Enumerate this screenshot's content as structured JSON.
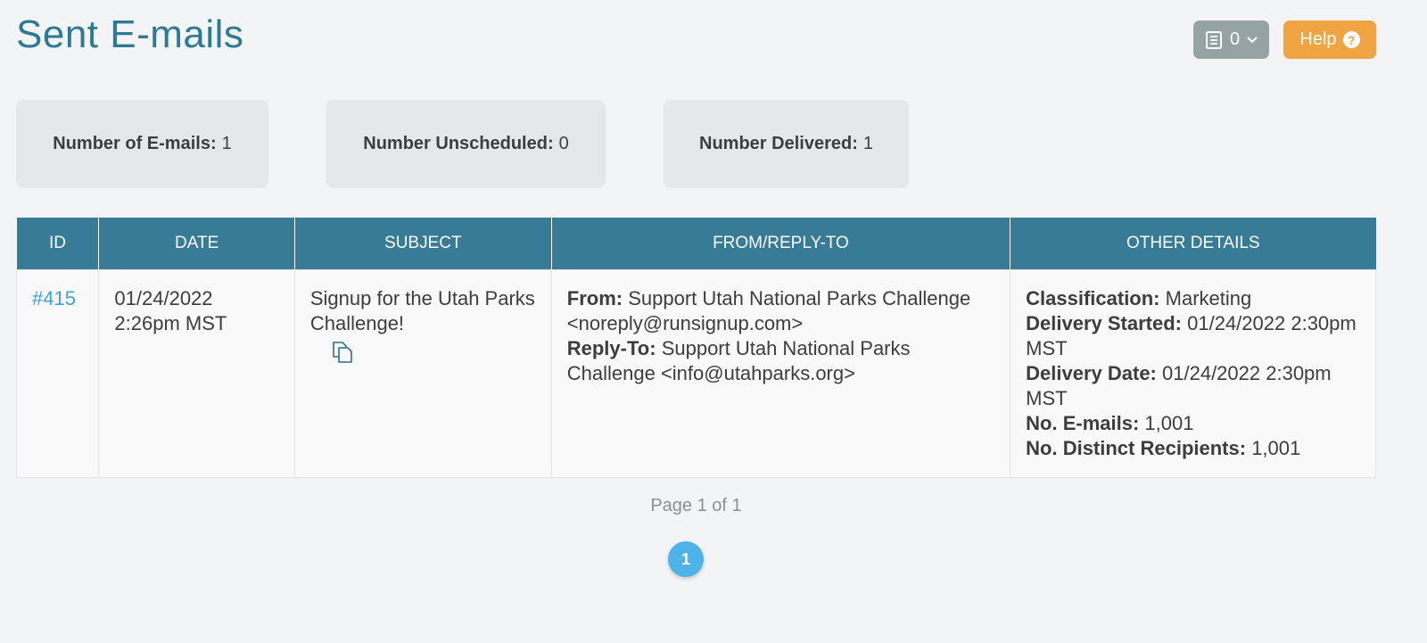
{
  "page": {
    "title": "Sent E-mails"
  },
  "toolbar": {
    "cart_count": "0",
    "help_label": "Help",
    "help_icon_glyph": "?"
  },
  "stats": [
    {
      "label": "Number of E-mails:",
      "value": "1"
    },
    {
      "label": "Number Unscheduled:",
      "value": "0"
    },
    {
      "label": "Number Delivered:",
      "value": "1"
    }
  ],
  "table": {
    "headers": [
      "ID",
      "DATE",
      "SUBJECT",
      "FROM/REPLY-TO",
      "OTHER DETAILS"
    ],
    "rows": [
      {
        "id": "#415",
        "date_line1": "01/24/2022",
        "date_line2": "2:26pm MST",
        "subject": "Signup for the Utah Parks Challenge!",
        "from_label": "From:",
        "from_value": "Support Utah National Parks Challenge <noreply@runsignup.com>",
        "reply_label": "Reply-To:",
        "reply_value": "Support Utah National Parks Challenge <info@utahparks.org>",
        "details": {
          "classification_label": "Classification:",
          "classification_value": "Marketing",
          "started_label": "Delivery Started:",
          "started_value": "01/24/2022 2:30pm MST",
          "date_label": "Delivery Date:",
          "date_value": "01/24/2022 2:30pm MST",
          "emails_label": "No. E-mails:",
          "emails_value": "1,001",
          "recipients_label": "No. Distinct Recipients:",
          "recipients_value": "1,001"
        }
      }
    ]
  },
  "pagination": {
    "info": "Page 1 of 1",
    "current": "1"
  },
  "icons": {
    "cart": "list-document-icon",
    "dropdown": "chevron-down-icon",
    "help": "question-circle-icon",
    "copy": "copy-icon"
  },
  "colors": {
    "title": "#2e7a94",
    "table_header": "#377b97",
    "help_button": "#f1a442",
    "cart_button": "#95a3a4",
    "link": "#3aa3d8",
    "page_bubble": "#4db3e8"
  }
}
